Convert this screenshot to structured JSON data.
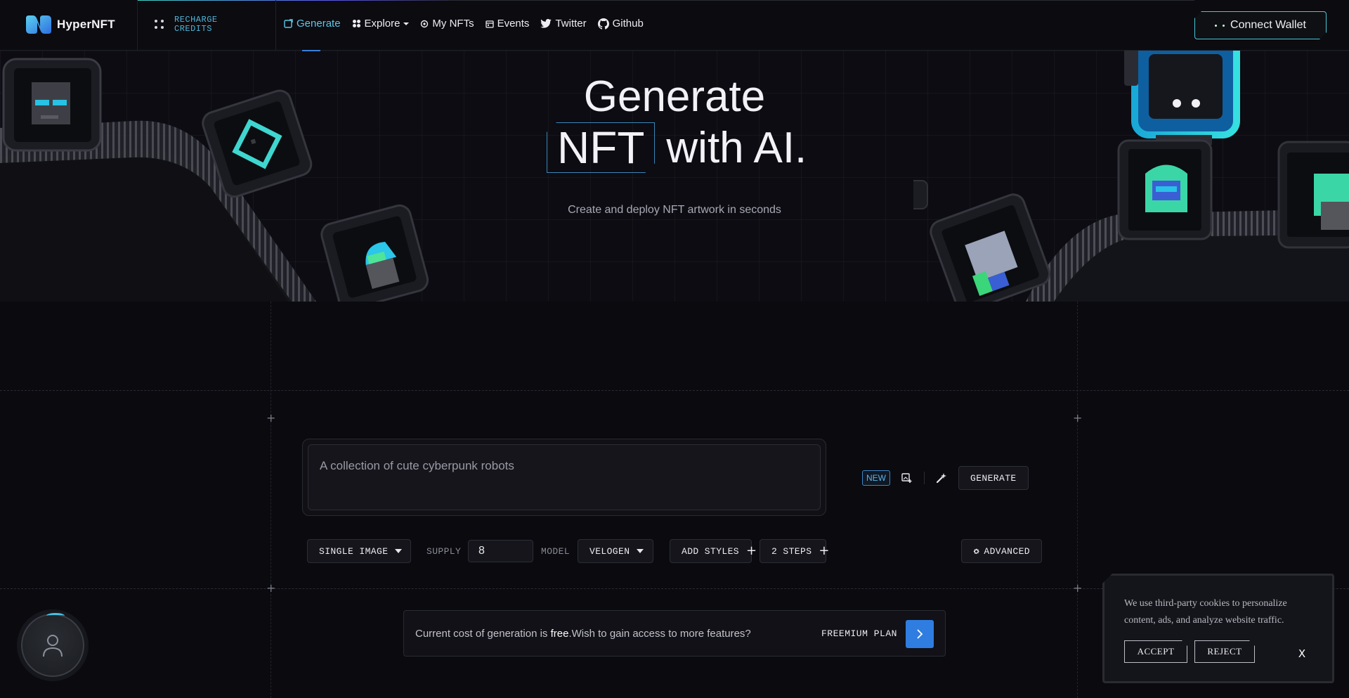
{
  "app": {
    "name": "HyperNFT"
  },
  "header": {
    "recharge_label_line1": "RECHARGE",
    "recharge_label_line2": "CREDITS",
    "nav": [
      {
        "label": "Generate",
        "icon": "generate-icon",
        "active": true
      },
      {
        "label": "Explore",
        "icon": "grid-icon",
        "has_dropdown": true
      },
      {
        "label": "My NFTs",
        "icon": "nft-icon"
      },
      {
        "label": "Events",
        "icon": "calendar-icon"
      },
      {
        "label": "Twitter",
        "icon": "twitter-icon"
      },
      {
        "label": "Github",
        "icon": "github-icon"
      }
    ],
    "connect_wallet": "Connect Wallet"
  },
  "hero": {
    "title_line1": "Generate",
    "title_highlight": "NFT",
    "title_rest": "with AI.",
    "subtitle": "Create and deploy NFT artwork in seconds"
  },
  "prompt": {
    "placeholder": "A collection of cute cyberpunk robots",
    "new_badge": "NEW",
    "generate_label": "GENERATE"
  },
  "options": {
    "output_type": "SINGLE IMAGE",
    "supply_label": "SUPPLY",
    "supply_value": "8",
    "model_label": "MODEL",
    "model_value": "VELOGEN",
    "add_styles": "ADD STYLES",
    "steps": "2 STEPS",
    "advanced": "ADVANCED"
  },
  "cost_banner": {
    "prefix": "Current cost of generation is ",
    "free": "free",
    "suffix": ".Wish to gain access to more features?",
    "plan": "FREEMIUM PLAN"
  },
  "cookie": {
    "text": "We use third-party cookies to personalize content, ads, and analyze website traffic.",
    "accept": "ACCEPT",
    "reject": "REJECT",
    "close": "X"
  },
  "colors": {
    "accent_cyan": "#4fb6d9",
    "accent_blue": "#2f7de0",
    "background": "#0a0a0f"
  }
}
